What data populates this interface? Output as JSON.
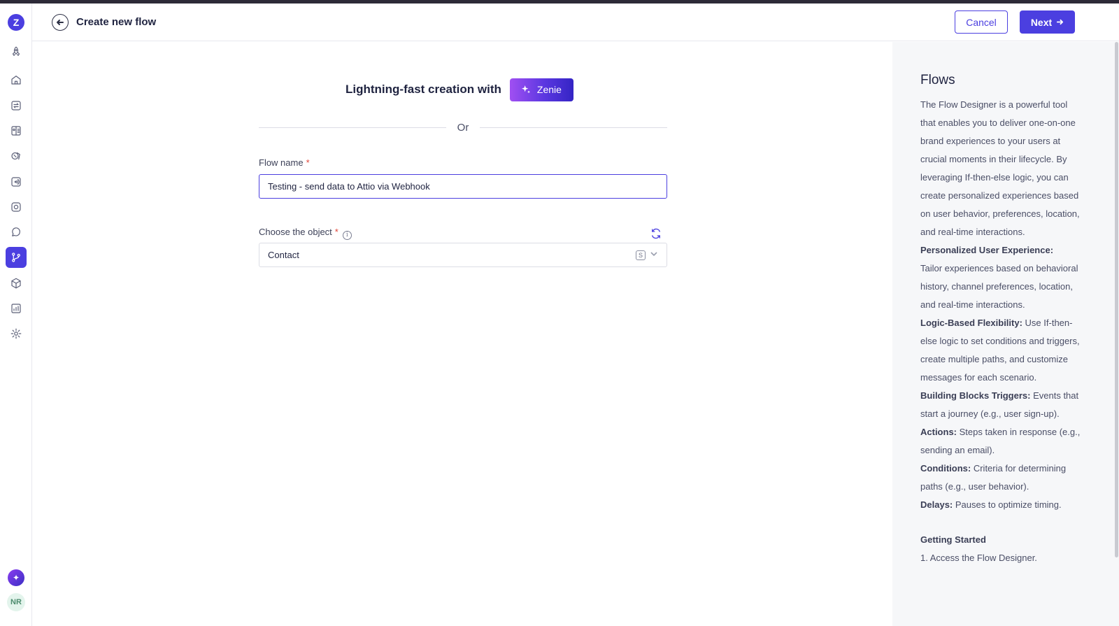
{
  "header": {
    "title": "Create new flow",
    "cancel_label": "Cancel",
    "next_label": "Next"
  },
  "sidebar": {
    "logo_letter": "Z",
    "items": [
      "launch",
      "home",
      "swap",
      "contacts",
      "segments",
      "broadcast",
      "instagram",
      "chat",
      "flows",
      "products",
      "analytics",
      "settings"
    ],
    "active": "flows",
    "avatar_initials": "NR"
  },
  "hero": {
    "text": "Lightning-fast creation with",
    "zenie_label": "Zenie"
  },
  "divider_text": "Or",
  "form": {
    "flow_name_label": "Flow name",
    "required_mark": "*",
    "flow_name_value": "Testing - send data to Attio via Webhook",
    "object_label": "Choose the object",
    "object_value": "Contact",
    "object_badge": "S",
    "info_glyph": "i"
  },
  "panel": {
    "title": "Flows",
    "intro": "The Flow Designer is a powerful tool that enables you to deliver one-on-one brand experiences to your users at crucial moments in their lifecycle. By leveraging If-then-else logic, you can create personalized experiences based on user behavior, preferences, location, and real-time interactions.",
    "p1_title": "Personalized User Experience:",
    "p1_text": "Tailor experiences based on behavioral history, channel preferences, location, and real-time interactions.",
    "p2_title": "Logic-Based Flexibility:",
    "p2_text": "Use If-then-else logic to set conditions and triggers, create multiple paths, and customize messages for each scenario.",
    "p3_title": "Building Blocks Triggers:",
    "p3_text": "Events that start a journey (e.g., user sign-up).",
    "p4_title": "Actions:",
    "p4_text": "Steps taken in response (e.g., sending an email).",
    "p5_title": "Conditions:",
    "p5_text": "Criteria for determining paths (e.g., user behavior).",
    "p6_title": "Delays:",
    "p6_text": "Pauses to optimize timing.",
    "getting_started_title": "Getting Started",
    "step1": "1. Access the Flow Designer."
  },
  "colors": {
    "accent": "#4b3fe0",
    "panel_bg": "#f6f7f9",
    "required": "#e0473a"
  }
}
